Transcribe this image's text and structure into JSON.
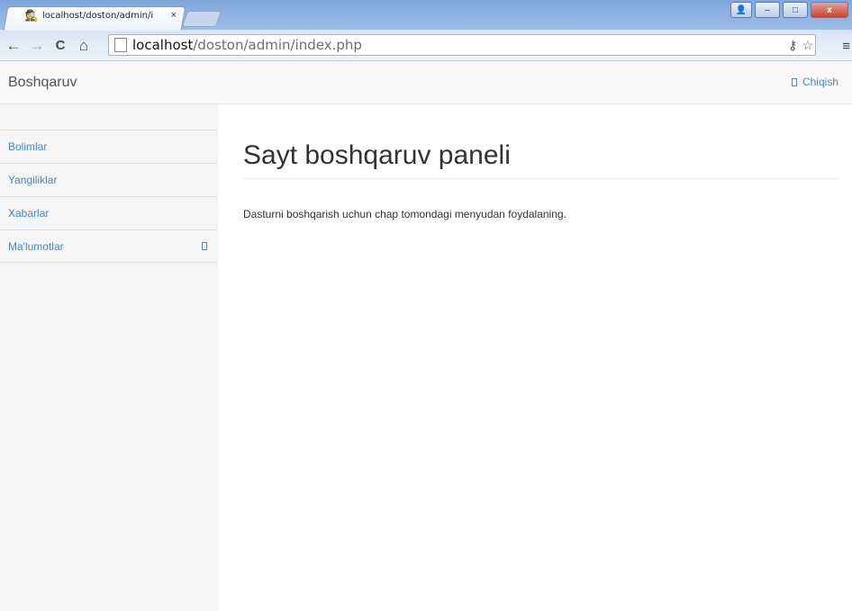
{
  "browser": {
    "tab_title": "localhost/doston/admin/i",
    "tab_close": "×",
    "url_host": "localhost",
    "url_path": "/doston/admin/index.php",
    "icons": {
      "back": "←",
      "forward": "→",
      "reload": "C",
      "home": "⌂",
      "key": "⚷",
      "star": "☆",
      "menu": "≡"
    },
    "window_buttons": {
      "user": "👤",
      "minimize": "–",
      "maximize": "□",
      "close": "x"
    }
  },
  "navbar": {
    "brand": "Boshqaruv",
    "logout_label": "Chiqish"
  },
  "sidebar": {
    "items": [
      {
        "label": "Bolimlar"
      },
      {
        "label": "Yangiliklar"
      },
      {
        "label": "Xabarlar"
      },
      {
        "label": "Ma'lumotlar"
      }
    ]
  },
  "main": {
    "title": "Sayt boshqaruv paneli",
    "description": "Dasturni boshqarish uchun chap tomondagi menyudan foydalaning."
  },
  "colors": {
    "link": "#428bca",
    "navbar_bg": "#f8f8f8",
    "sidebar_bg": "#f5f5f5"
  }
}
